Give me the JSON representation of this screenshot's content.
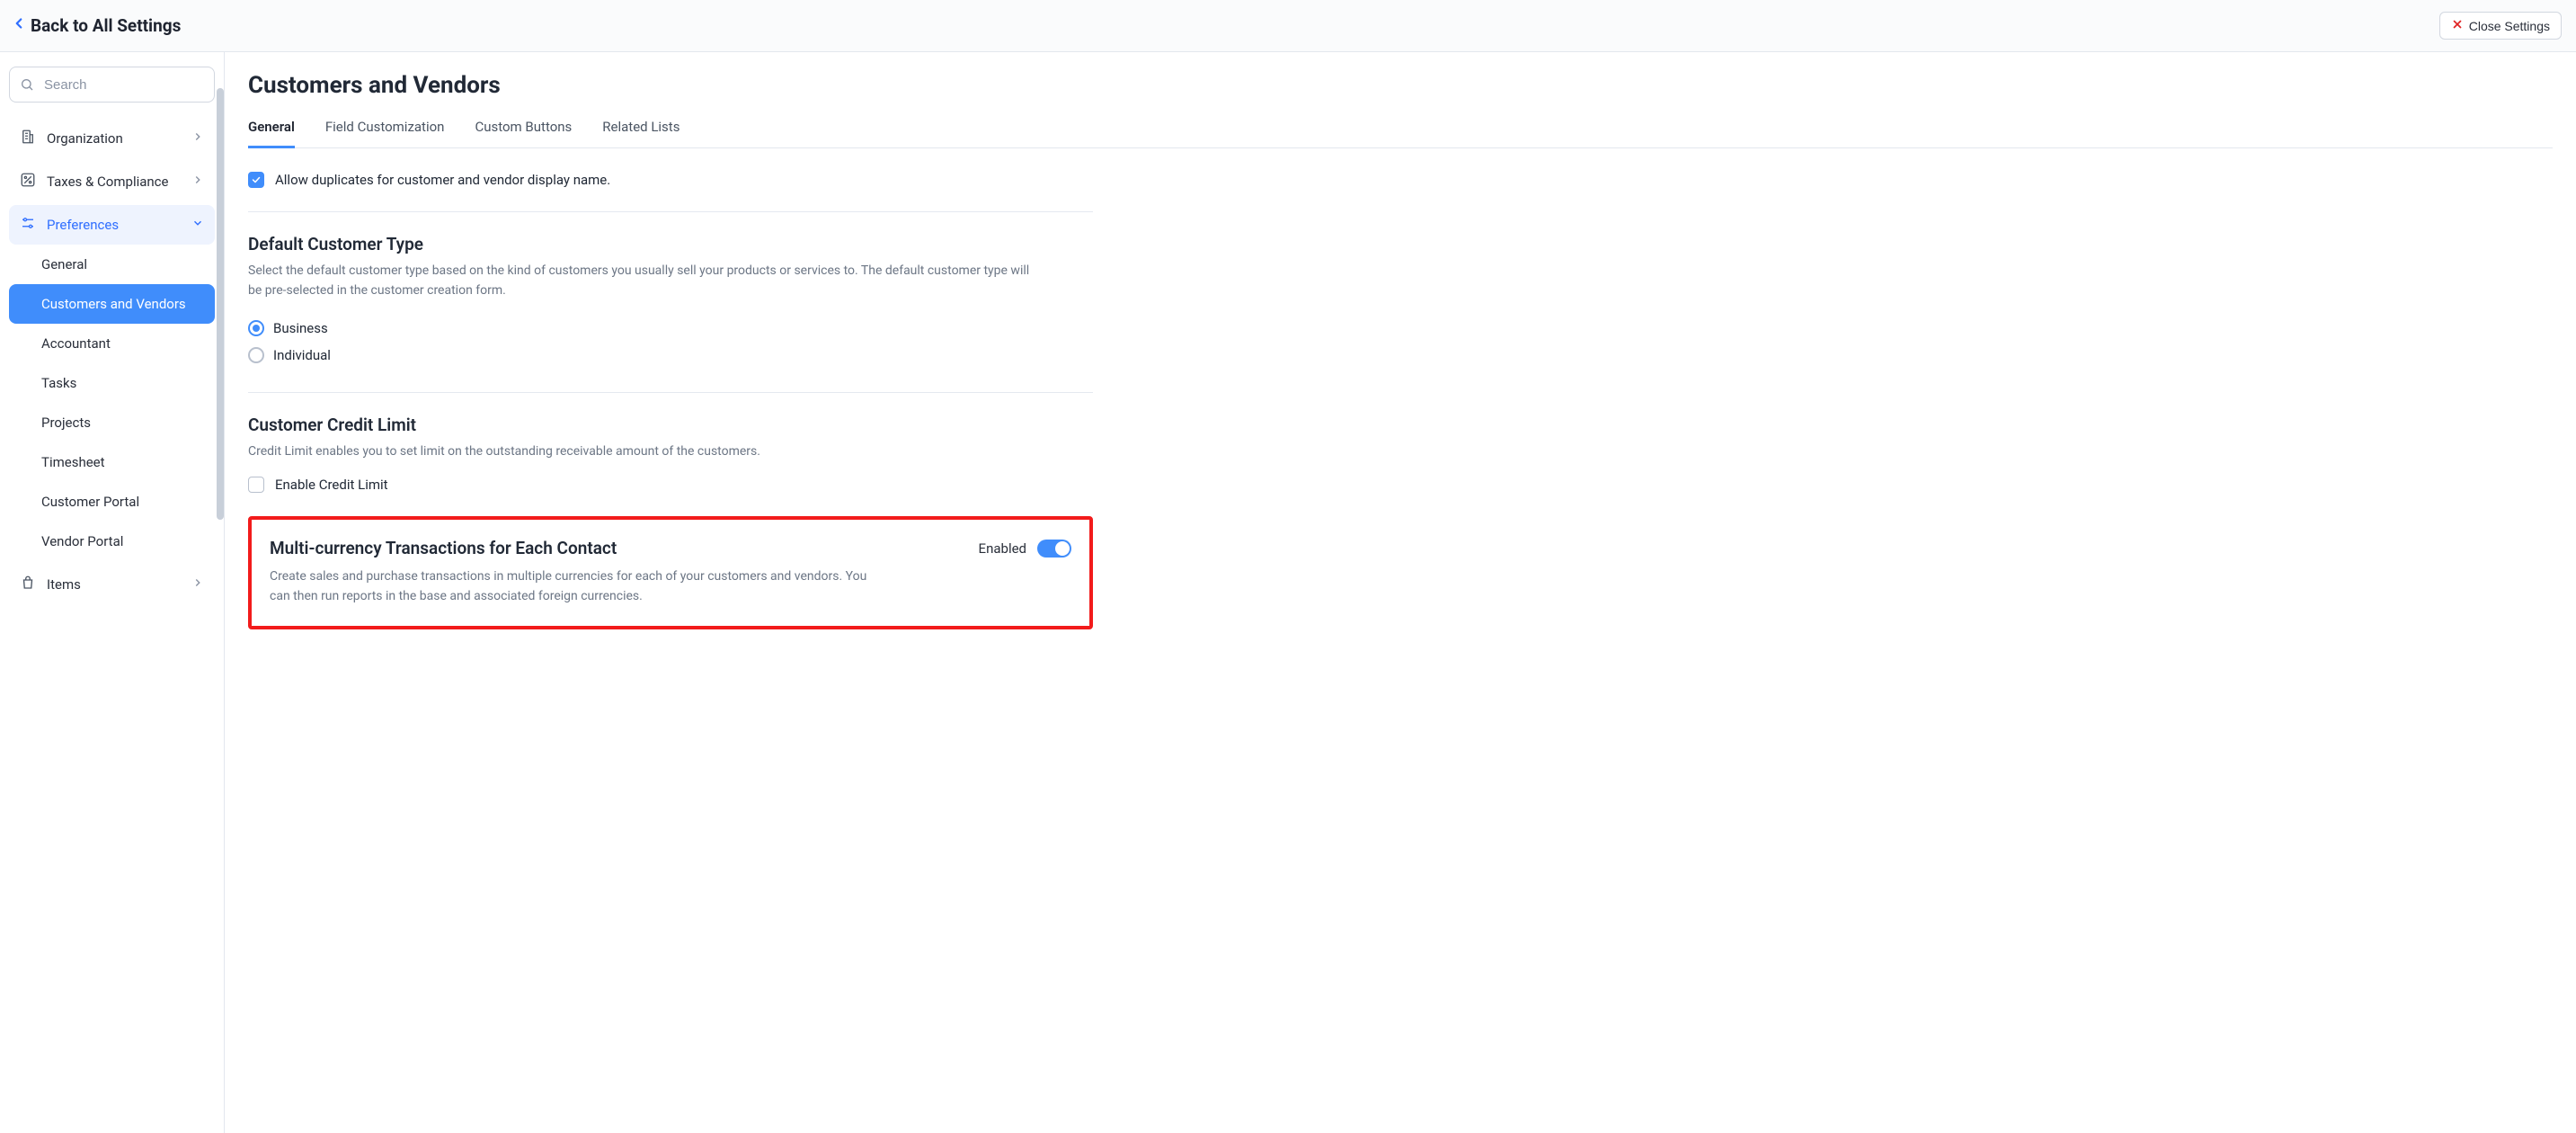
{
  "header": {
    "back_label": "Back to All Settings",
    "close_label": "Close Settings"
  },
  "sidebar": {
    "search_placeholder": "Search",
    "items": [
      {
        "id": "organization",
        "label": "Organization",
        "icon": "building-icon",
        "has_children": true,
        "open": false,
        "active": false
      },
      {
        "id": "taxes",
        "label": "Taxes & Compliance",
        "icon": "percent-icon",
        "has_children": true,
        "open": false,
        "active": false
      },
      {
        "id": "preferences",
        "label": "Preferences",
        "icon": "sliders-icon",
        "has_children": true,
        "open": true,
        "active": false
      },
      {
        "id": "pref-general",
        "label": "General",
        "level": 2
      },
      {
        "id": "pref-cv",
        "label": "Customers and Vendors",
        "level": 2,
        "active": true
      },
      {
        "id": "pref-acct",
        "label": "Accountant",
        "level": 2
      },
      {
        "id": "pref-tasks",
        "label": "Tasks",
        "level": 2
      },
      {
        "id": "pref-projects",
        "label": "Projects",
        "level": 2
      },
      {
        "id": "pref-timesheet",
        "label": "Timesheet",
        "level": 2
      },
      {
        "id": "pref-cportal",
        "label": "Customer Portal",
        "level": 2
      },
      {
        "id": "pref-vportal",
        "label": "Vendor Portal",
        "level": 2
      },
      {
        "id": "items",
        "label": "Items",
        "icon": "bag-icon",
        "has_children": true,
        "open": false,
        "active": false
      }
    ]
  },
  "main": {
    "title": "Customers and Vendors",
    "tabs": [
      {
        "label": "General",
        "active": true
      },
      {
        "label": "Field Customization",
        "active": false
      },
      {
        "label": "Custom Buttons",
        "active": false
      },
      {
        "label": "Related Lists",
        "active": false
      }
    ],
    "allow_duplicates": {
      "label": "Allow duplicates for customer and vendor display name.",
      "checked": true
    },
    "default_type": {
      "heading": "Default Customer Type",
      "desc": "Select the default customer type based on the kind of customers you usually sell your products or services to. The default customer type will be pre-selected in the customer creation form.",
      "options": [
        {
          "label": "Business",
          "checked": true
        },
        {
          "label": "Individual",
          "checked": false
        }
      ]
    },
    "credit_limit": {
      "heading": "Customer Credit Limit",
      "desc": "Credit Limit enables you to set limit on the outstanding receivable amount of the customers.",
      "checkbox_label": "Enable Credit Limit",
      "checked": false
    },
    "multi_currency": {
      "heading": "Multi-currency Transactions for Each Contact",
      "status_label": "Enabled",
      "desc": "Create sales and purchase transactions in multiple currencies for each of your customers and vendors. You can then run reports in the base and associated foreign currencies."
    }
  }
}
